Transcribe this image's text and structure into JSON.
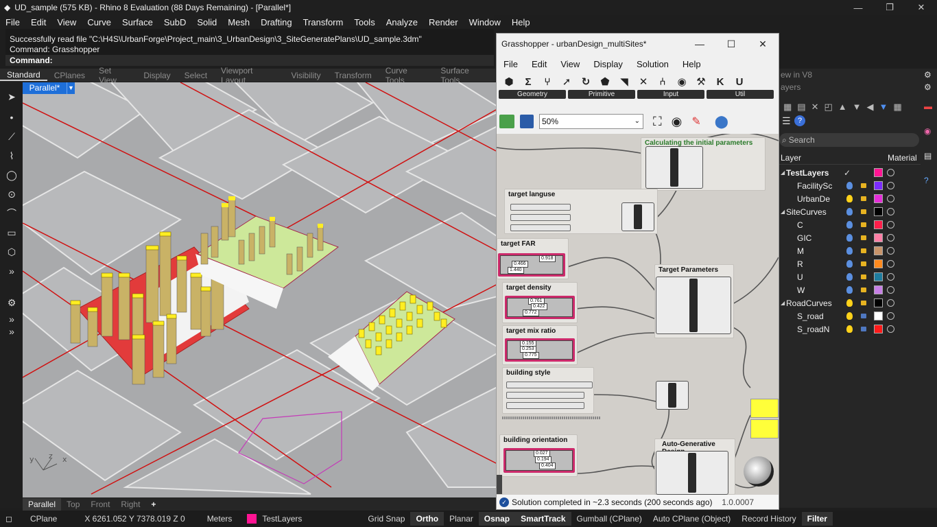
{
  "window": {
    "title": "UD_sample (575 KB) - Rhino 8 Evaluation (88 Days Remaining) - [Parallel*]",
    "controls": [
      "—",
      "❐",
      "✕"
    ]
  },
  "menu": [
    "File",
    "Edit",
    "View",
    "Curve",
    "Surface",
    "SubD",
    "Solid",
    "Mesh",
    "Drafting",
    "Transform",
    "Tools",
    "Analyze",
    "Render",
    "Window",
    "Help"
  ],
  "command": {
    "history": [
      "Successfully read file \"C:\\H4S\\UrbanForge\\Project_main\\3_UrbanDesign\\3_SiteGeneratePlans\\UD_sample.3dm\"",
      "Command: Grasshopper"
    ],
    "prompt": "Command:"
  },
  "toolbar_tabs": [
    "Standard",
    "CPlanes",
    "Set View",
    "Display",
    "Select",
    "Viewport Layout",
    "Visibility",
    "Transform",
    "Curve Tools",
    "Surface Tools"
  ],
  "viewport": {
    "label": "Parallel*",
    "tabs": [
      "Parallel",
      "Top",
      "Front",
      "Right"
    ],
    "add_tab": "+",
    "axis_labels": [
      "y",
      "z",
      "x"
    ]
  },
  "status": {
    "cplane": "CPlane",
    "coords": "X 6261.052 Y 7378.019 Z 0",
    "units": "Meters",
    "layer": "TestLayers",
    "items": [
      "Grid Snap",
      "Ortho",
      "Planar",
      "Osnap",
      "SmartTrack",
      "Gumball (CPlane)",
      "Auto CPlane (Object)",
      "Record History",
      "Filter"
    ],
    "bold_items": [
      "Ortho",
      "Osnap",
      "SmartTrack",
      "Filter"
    ]
  },
  "grasshopper": {
    "title": "Grasshopper - urbanDesign_multiSites*",
    "menu": [
      "File",
      "Edit",
      "View",
      "Display",
      "Solution",
      "Help"
    ],
    "component_tabs": [
      "⬢",
      "Σ",
      "⑂",
      "➚",
      "↻",
      "⬟",
      "◥",
      "✕",
      "⑃",
      "◉",
      "⚒",
      "K",
      "U"
    ],
    "groups": [
      "Geometry",
      "Primitive",
      "Input",
      "Util"
    ],
    "zoom": "50%",
    "canvas_groups": [
      {
        "label": "Calculating the initial parameters"
      },
      {
        "label": "target languse"
      },
      {
        "label": "target FAR"
      },
      {
        "label": "target density"
      },
      {
        "label": "target mix ratio"
      },
      {
        "label": "building style"
      },
      {
        "label": "Target Parameters"
      },
      {
        "label": "building orientation"
      },
      {
        "label": "Auto-Generative Design"
      }
    ],
    "slider_values": {
      "far": [
        "0.918",
        "0.466",
        "1.440"
      ],
      "density": [
        "0.761",
        "0.422",
        "0.772"
      ],
      "mix": [
        "0.155",
        "0.253",
        "0.775"
      ],
      "orientation": [
        "0.027",
        "0.194",
        "0.404"
      ]
    },
    "status_message": "Solution completed in ~2.3 seconds (200 seconds ago)",
    "version": "1.0.0007"
  },
  "panel": {
    "header_text": "ew in V8",
    "layers_title": "ayers",
    "search_placeholder": "Search",
    "col_layer": "Layer",
    "col_material": "Material",
    "layers": [
      {
        "name": "TestLayers",
        "indent": 0,
        "color": "#ff1493",
        "bold": true,
        "expander": "◢",
        "bulb": "",
        "lock": ""
      },
      {
        "name": "FacilitySc",
        "indent": 1,
        "color": "#7b2cff",
        "bold": false,
        "expander": "",
        "bulb": "#5b8fe0",
        "lock": "#e7b321"
      },
      {
        "name": "UrbanDe",
        "indent": 1,
        "color": "#e52ed8",
        "bold": false,
        "expander": "",
        "bulb": "#ffd21a",
        "lock": "#e7b321"
      },
      {
        "name": "SiteCurves",
        "indent": 0,
        "color": "#000000",
        "bold": false,
        "expander": "◢",
        "bulb": "#5b8fe0",
        "lock": "#e7b321"
      },
      {
        "name": "C",
        "indent": 1,
        "color": "#ff1e4a",
        "bold": false,
        "expander": "",
        "bulb": "#5b8fe0",
        "lock": "#e7b321"
      },
      {
        "name": "GIC",
        "indent": 1,
        "color": "#ff7fa6",
        "bold": false,
        "expander": "",
        "bulb": "#5b8fe0",
        "lock": "#e7b321"
      },
      {
        "name": "M",
        "indent": 1,
        "color": "#c8946a",
        "bold": false,
        "expander": "",
        "bulb": "#5b8fe0",
        "lock": "#e7b321"
      },
      {
        "name": "R",
        "indent": 1,
        "color": "#ff8a1e",
        "bold": false,
        "expander": "",
        "bulb": "#5b8fe0",
        "lock": "#e7b321"
      },
      {
        "name": "U",
        "indent": 1,
        "color": "#1e7c9e",
        "bold": false,
        "expander": "",
        "bulb": "#5b8fe0",
        "lock": "#e7b321"
      },
      {
        "name": "W",
        "indent": 1,
        "color": "#c77fe6",
        "bold": false,
        "expander": "",
        "bulb": "#5b8fe0",
        "lock": "#e7b321"
      },
      {
        "name": "RoadCurves",
        "indent": 0,
        "color": "#000000",
        "bold": false,
        "expander": "◢",
        "bulb": "#ffd21a",
        "lock": "#e7b321"
      },
      {
        "name": "S_road",
        "indent": 1,
        "color": "#ffffff",
        "bold": false,
        "expander": "",
        "bulb": "#ffd21a",
        "lock": "#4f78c0"
      },
      {
        "name": "S_roadN",
        "indent": 1,
        "color": "#ff1a1a",
        "bold": false,
        "expander": "",
        "bulb": "#ffd21a",
        "lock": "#4f78c0"
      }
    ]
  }
}
